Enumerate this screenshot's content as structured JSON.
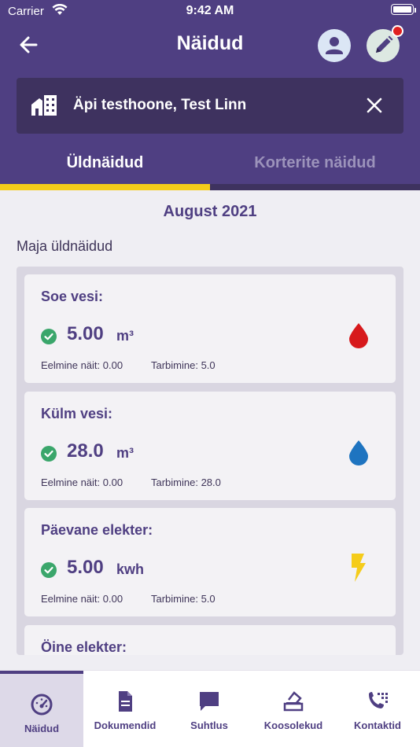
{
  "status_bar": {
    "carrier": "Carrier",
    "time": "9:42 AM"
  },
  "header": {
    "title": "Näidud"
  },
  "building": {
    "name": "Äpi testhoone, Test Linn"
  },
  "tabs": [
    {
      "label": "Üldnäidud",
      "active": true
    },
    {
      "label": "Korterite näidud",
      "active": false
    }
  ],
  "month": "August 2021",
  "section_title": "Maja üldnäidud",
  "meters": [
    {
      "label": "Soe vesi:",
      "value": "5.00",
      "unit": "m³",
      "previous": "Eelmine näit: 0.00",
      "consumption": "Tarbimine: 5.0",
      "icon": "hot-water-drop-icon",
      "color": "#d7191c"
    },
    {
      "label": "Külm vesi:",
      "value": "28.0",
      "unit": "m³",
      "previous": "Eelmine näit: 0.00",
      "consumption": "Tarbimine: 28.0",
      "icon": "cold-water-drop-icon",
      "color": "#1e74c0"
    },
    {
      "label": "Päevane elekter:",
      "value": "5.00",
      "unit": "kwh",
      "previous": "Eelmine näit: 0.00",
      "consumption": "Tarbimine: 5.0",
      "icon": "lightning-icon",
      "color": "#f5cc1a"
    },
    {
      "label": "Öine elekter:"
    }
  ],
  "bottom_nav": [
    {
      "label": "Näidud",
      "icon": "gauge-icon",
      "active": true
    },
    {
      "label": "Dokumendid",
      "icon": "document-icon",
      "active": false
    },
    {
      "label": "Suhtlus",
      "icon": "chat-icon",
      "active": false
    },
    {
      "label": "Koosolekud",
      "icon": "ballot-icon",
      "active": false
    },
    {
      "label": "Kontaktid",
      "icon": "phone-book-icon",
      "active": false
    }
  ],
  "colors": {
    "primary": "#4f3f82",
    "accent": "#f5cc1a",
    "success": "#3aa66b",
    "notification": "#e02020"
  }
}
